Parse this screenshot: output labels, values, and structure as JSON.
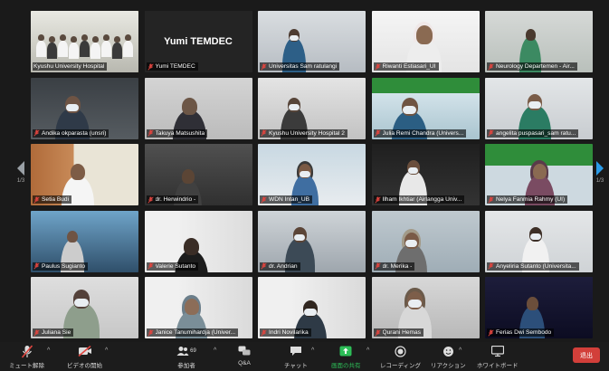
{
  "grid": {
    "tiles": [
      {
        "name": "Kyushu University Hospital",
        "muted": false,
        "active": true
      },
      {
        "name": "Yumi TEMDEC",
        "muted": true,
        "card": "Yumi TEMDEC"
      },
      {
        "name": "Universitas Sam ratulangi",
        "muted": true
      },
      {
        "name": "Riwanti Estiasari_UI",
        "muted": true
      },
      {
        "name": "Neurology Departemen - Air...",
        "muted": true
      },
      {
        "name": "Andika okparasta (unsri)",
        "muted": true
      },
      {
        "name": "Takuya Matsushita",
        "muted": true
      },
      {
        "name": "Kyushu University Hospital 2",
        "muted": true
      },
      {
        "name": "Julia Remi Chandra (Univers...",
        "muted": true
      },
      {
        "name": "angelita puspasari_sam ratu...",
        "muted": true
      },
      {
        "name": "Setia Budi",
        "muted": true
      },
      {
        "name": "dr. Herwindrio -",
        "muted": true
      },
      {
        "name": "WDN Intan_UB",
        "muted": true
      },
      {
        "name": "Ilham Ikhtiar (Airlangga Univ...",
        "muted": true
      },
      {
        "name": "Nelya Fanmia Rahmy (UI)",
        "muted": true
      },
      {
        "name": "Paulus Sugianto",
        "muted": true
      },
      {
        "name": "Valerie Sutanto",
        "muted": true
      },
      {
        "name": "dr. Andrian",
        "muted": true
      },
      {
        "name": "dr. Merika -",
        "muted": true
      },
      {
        "name": "Anyeliria Sutanto (Universita...",
        "muted": true
      },
      {
        "name": "Juliana Sie",
        "muted": true
      },
      {
        "name": "Janice Tanumihardja (Univer...",
        "muted": true
      },
      {
        "name": "Indri Novilarika",
        "muted": true
      },
      {
        "name": "Qurani Hemas",
        "muted": true
      },
      {
        "name": "Ferias Dwi Sembodo",
        "muted": true
      }
    ]
  },
  "pagination": {
    "left": "1/3",
    "right": "1/3"
  },
  "toolbar": {
    "mute": "ミュート解除",
    "video": "ビデオの開始",
    "participants": "参加者",
    "participants_count": "69",
    "qa": "Q&A",
    "chat": "チャット",
    "share": "画面の共有",
    "record": "レコーディング",
    "reactions": "リアクション",
    "whiteboard": "ホワイトボード",
    "end": "退出"
  },
  "colors": {
    "active_outline": "#d6e04a",
    "share_green": "#2dbd57",
    "end_red": "#d23f3a",
    "muted_icon": "#e0453f"
  }
}
